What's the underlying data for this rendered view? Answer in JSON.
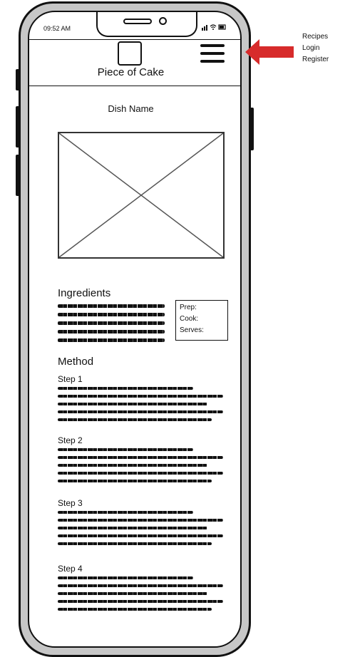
{
  "status_bar": {
    "time": "09:52 AM",
    "icons": "▮▮ ◔ ▭"
  },
  "header": {
    "brand": "Piece of Cake"
  },
  "main": {
    "dish_name": "Dish Name",
    "ingredients_title": "Ingredients",
    "info_box": {
      "prep": "Prep:",
      "cook": "Cook:",
      "serves": "Serves:"
    },
    "method_title": "Method",
    "steps": [
      {
        "label": "Step 1"
      },
      {
        "label": "Step 2"
      },
      {
        "label": "Step 3"
      },
      {
        "label": "Step 4"
      }
    ]
  },
  "menu": {
    "items": [
      "Recipes",
      "Login",
      "Register"
    ]
  },
  "colors": {
    "arrow": "#d72b2b",
    "frame": "#c7c7c7"
  },
  "icons": {
    "menu": "hamburger-icon",
    "logo": "logo-placeholder",
    "image": "image-placeholder"
  }
}
